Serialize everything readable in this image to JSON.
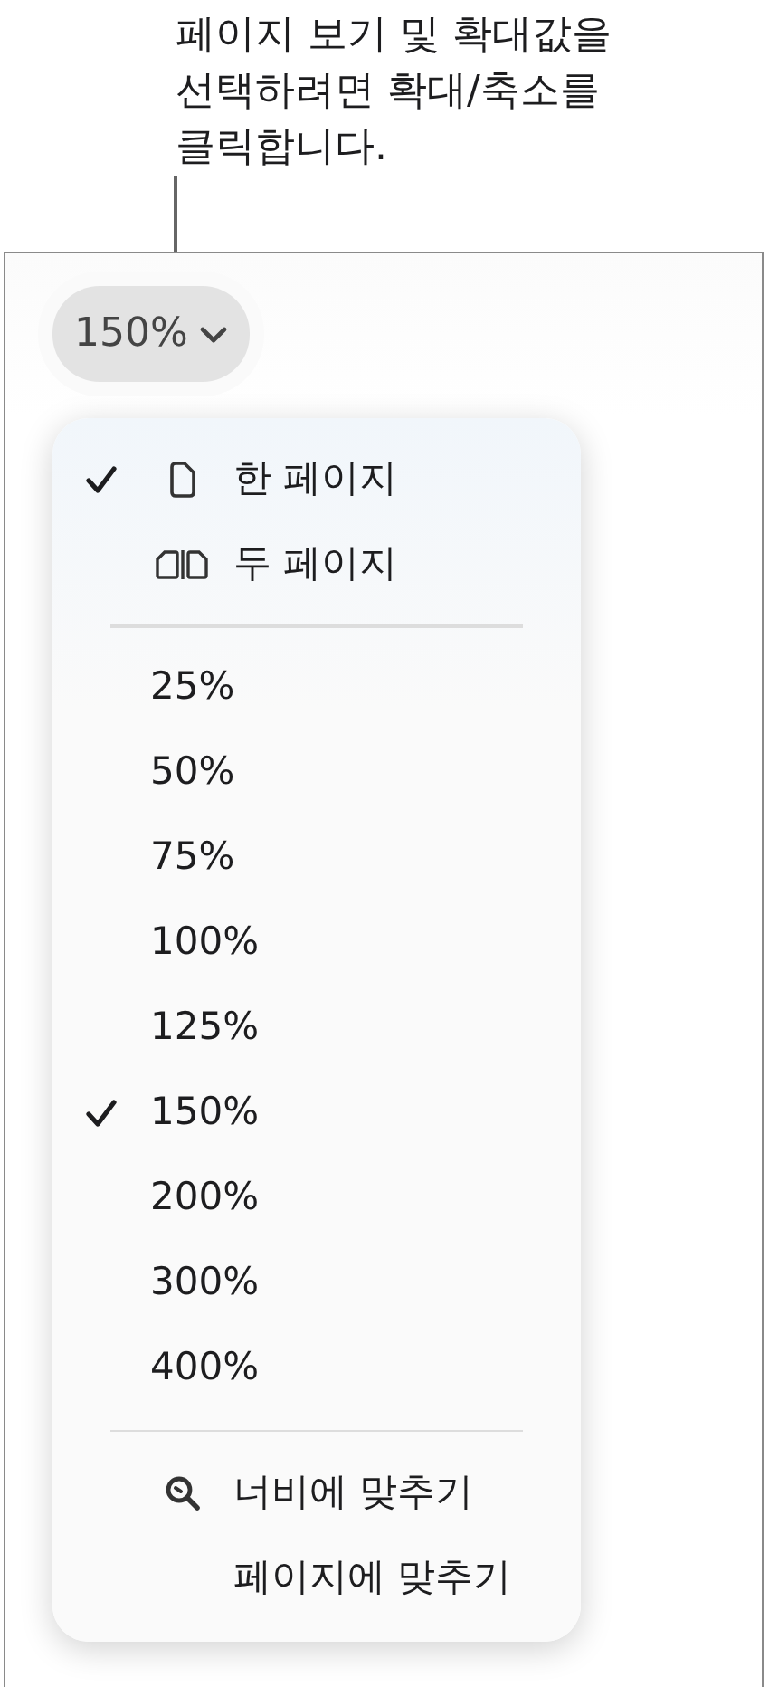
{
  "callout": {
    "lines": [
      "페이지 보기 및 확대값을",
      "선택하려면 확대/축소를",
      "클릭합니다."
    ]
  },
  "zoom_button": {
    "label": "150%"
  },
  "menu": {
    "view_items": [
      {
        "label": "한 페이지",
        "kind": "page",
        "checked": true
      },
      {
        "label": "두 페이지",
        "kind": "two-pages",
        "checked": false
      }
    ],
    "zoom_items": [
      {
        "label": "25%",
        "checked": false
      },
      {
        "label": "50%",
        "checked": false
      },
      {
        "label": "75%",
        "checked": false
      },
      {
        "label": "100%",
        "checked": false
      },
      {
        "label": "125%",
        "checked": false
      },
      {
        "label": "150%",
        "checked": true
      },
      {
        "label": "200%",
        "checked": false
      },
      {
        "label": "300%",
        "checked": false
      },
      {
        "label": "400%",
        "checked": false
      }
    ],
    "fit_items": [
      {
        "label": "너비에 맞추기",
        "kind": "zoom"
      },
      {
        "label": "페이지에 맞추기",
        "kind": "none"
      }
    ]
  }
}
